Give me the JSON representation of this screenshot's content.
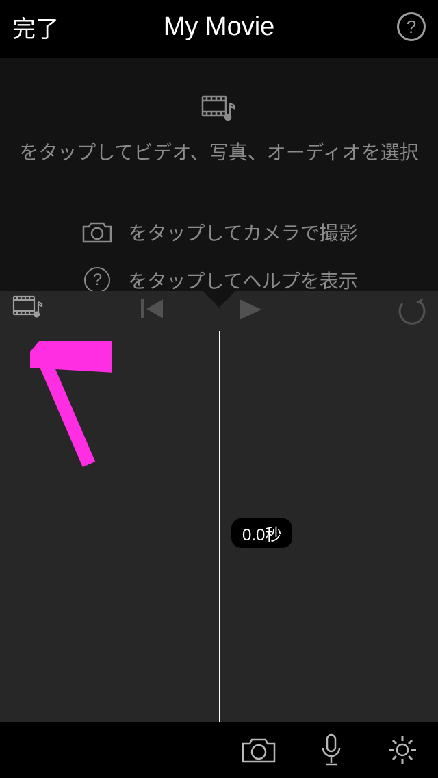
{
  "header": {
    "done": "完了",
    "title": "My Movie",
    "help": "?"
  },
  "hints": {
    "line1": "をタップしてビデオ、写真、オーディオを選択",
    "camera": "をタップしてカメラで撮影",
    "help": "をタップしてヘルプを表示",
    "help_icon": "?"
  },
  "timeline": {
    "time": "0.0秒"
  }
}
